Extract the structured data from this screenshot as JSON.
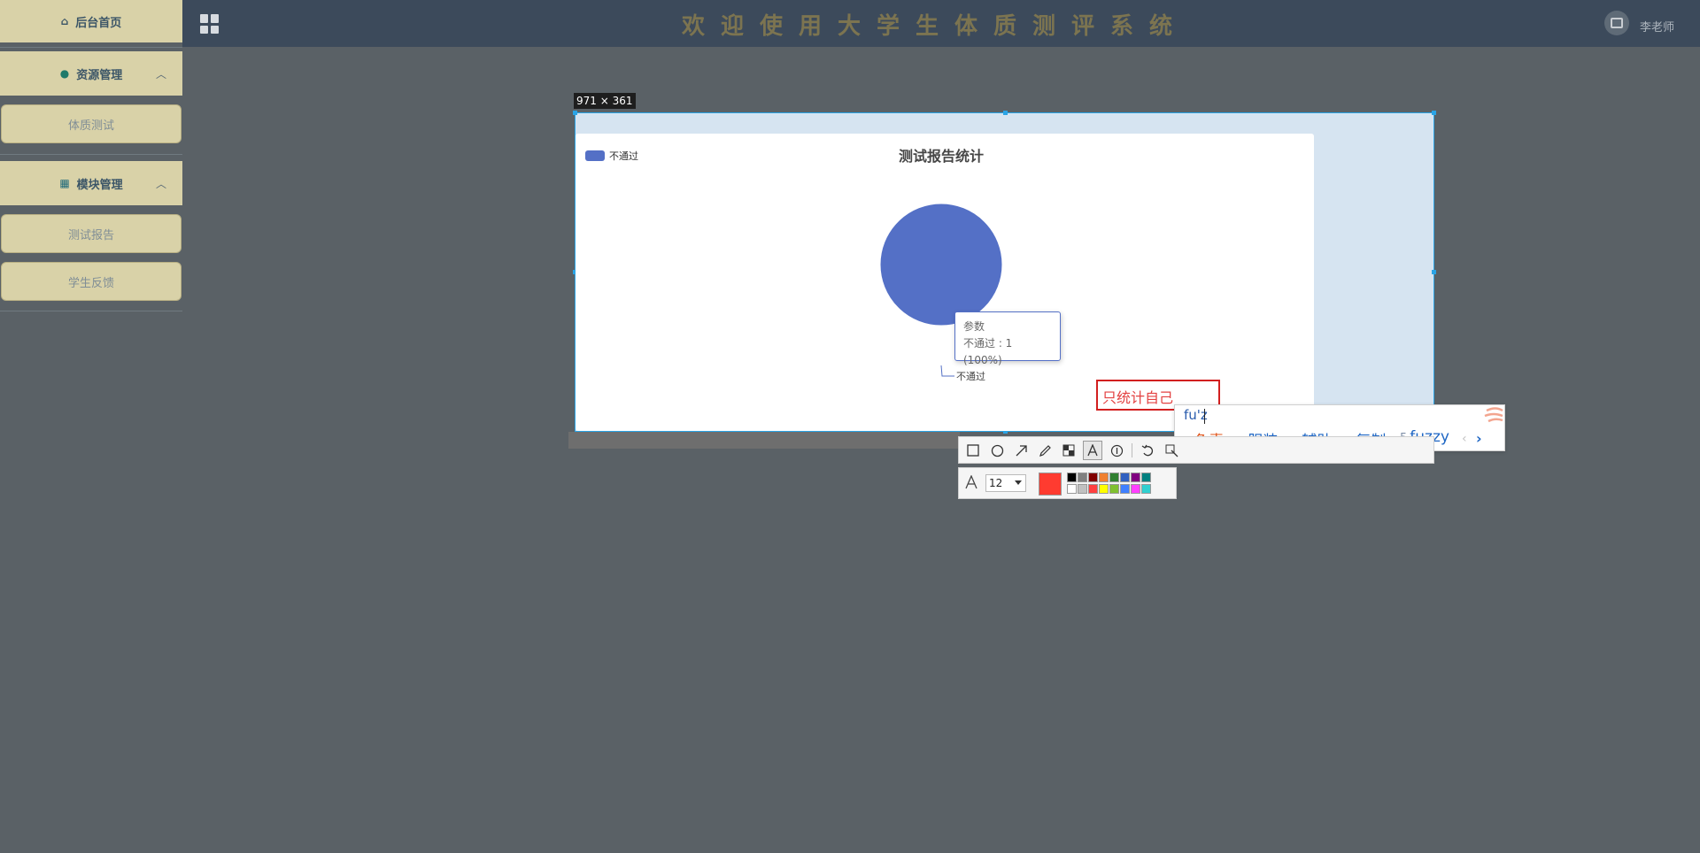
{
  "sidebar": {
    "home": {
      "label": "后台首页",
      "icon": "home-icon"
    },
    "resource": {
      "label": "资源管理",
      "icon": "location-pin-icon",
      "expanded": true,
      "items": [
        {
          "label": "体质测试"
        }
      ]
    },
    "module": {
      "label": "模块管理",
      "icon": "grid-icon",
      "expanded": true,
      "items": [
        {
          "label": "测试报告"
        },
        {
          "label": "学生反馈"
        }
      ]
    }
  },
  "header": {
    "title": "欢迎使用大学生体质测评系统",
    "user": "李老师",
    "menu_icon": "apps-grid-icon",
    "avatar_icon": "image-icon"
  },
  "capture": {
    "size_label": "971 × 361"
  },
  "chart_data": {
    "type": "pie",
    "title": "测试报告统计",
    "legend": {
      "position": "top-left",
      "entries": [
        "不通过"
      ]
    },
    "slices": [
      {
        "name": "不通过",
        "value": 1,
        "percent": 100,
        "color": "#5470c6"
      }
    ],
    "slice_label": "不通过",
    "tooltip": {
      "series": "参数",
      "line": "不通过 : 1 (100%)"
    }
  },
  "annotation": {
    "text": "只统计自己"
  },
  "ime": {
    "input": "fu'z",
    "candidates": [
      {
        "num": "1",
        "text": "负责"
      },
      {
        "num": "2",
        "text": "服装"
      },
      {
        "num": "3",
        "text": "辅助"
      },
      {
        "num": "4",
        "text": "复制"
      },
      {
        "num": "5",
        "text": "fuzzy"
      }
    ],
    "prev": "‹",
    "next": "›"
  },
  "toolbar": {
    "tools": [
      "rectangle-icon",
      "ellipse-icon",
      "arrow-icon",
      "pen-icon",
      "mosaic-icon",
      "text-icon",
      "number-icon",
      "undo-icon",
      "pin-icon"
    ],
    "font_size": "12",
    "current_color": "#ff3b30",
    "palette_top": [
      "#000000",
      "#808080",
      "#800000",
      "#f08030",
      "#308030",
      "#3060c0",
      "#800080",
      "#008080"
    ],
    "palette_bottom": [
      "#ffffff",
      "#c0c0c0",
      "#ff4040",
      "#ffff00",
      "#80c030",
      "#4080ff",
      "#ff40ff",
      "#30d0d0"
    ]
  }
}
